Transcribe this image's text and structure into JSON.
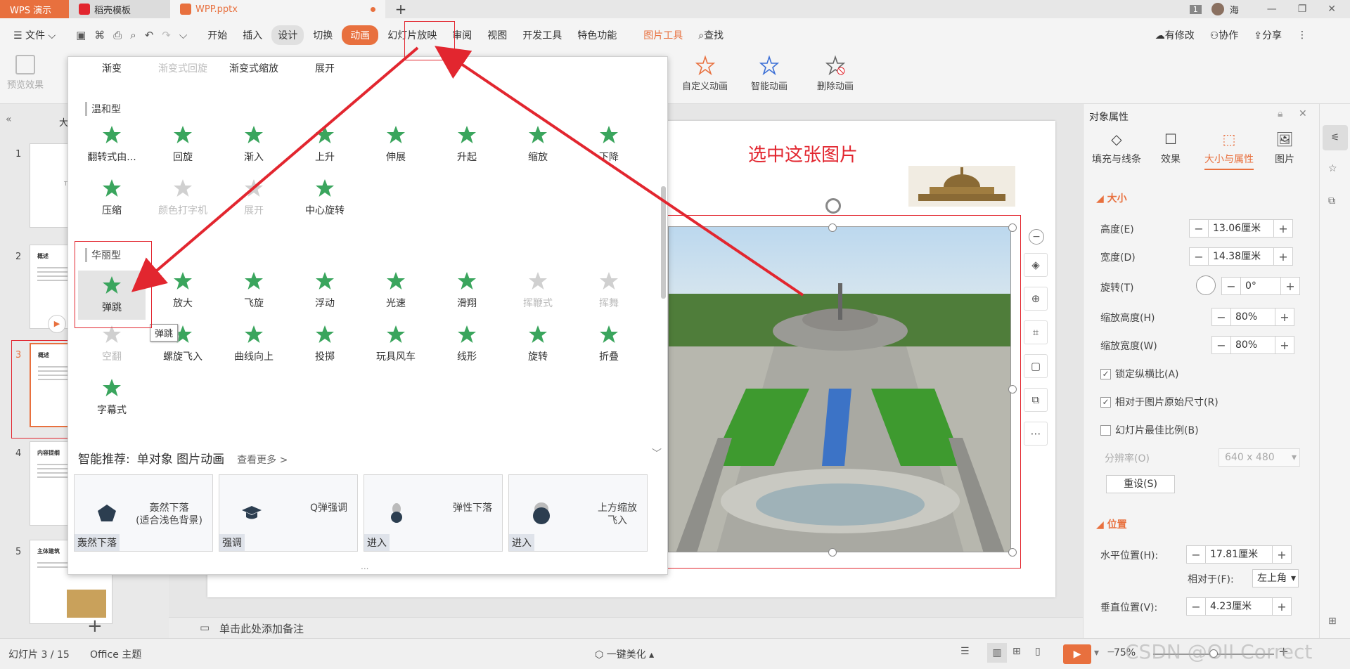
{
  "titlebar": {
    "app_tab": "WPS 演示",
    "template_tab": "稻壳模板",
    "doc_tab": "WPP.pptx",
    "user_name": "海",
    "badge": "1"
  },
  "menubar": {
    "file": "文件",
    "items": [
      "开始",
      "插入",
      "设计",
      "切换",
      "动画",
      "幻灯片放映",
      "审阅",
      "视图",
      "开发工具",
      "特色功能"
    ],
    "picture_tools": "图片工具",
    "search": "查找",
    "right": {
      "modified": "有修改",
      "collab": "协作",
      "share": "分享"
    }
  },
  "ribbon": {
    "preview": "预览效果",
    "custom_anim": "自定义动画",
    "smart_anim": "智能动画",
    "delete_anim": "删除动画"
  },
  "left": {
    "collapse_label": "大",
    "slides": [
      {
        "num": "1",
        "title": "",
        "preview": "T"
      },
      {
        "num": "2",
        "title": "概述"
      },
      {
        "num": "3",
        "title": "概述"
      },
      {
        "num": "4",
        "title": "内容提纲"
      },
      {
        "num": "5",
        "title": "主体建筑"
      }
    ]
  },
  "slide": {
    "title": "选中这张图片"
  },
  "dropdown": {
    "top_row": [
      {
        "label": "渐变",
        "disabled": false
      },
      {
        "label": "渐变式回旋",
        "disabled": true
      },
      {
        "label": "渐变式缩放",
        "disabled": false
      },
      {
        "label": "展开",
        "disabled": false
      }
    ],
    "section_mild": "温和型",
    "mild": [
      {
        "label": "翻转式由...",
        "disabled": false
      },
      {
        "label": "回旋",
        "disabled": false
      },
      {
        "label": "渐入",
        "disabled": false
      },
      {
        "label": "上升",
        "disabled": false
      },
      {
        "label": "伸展",
        "disabled": false
      },
      {
        "label": "升起",
        "disabled": false
      },
      {
        "label": "缩放",
        "disabled": false
      },
      {
        "label": "下降",
        "disabled": false
      },
      {
        "label": "压缩",
        "disabled": false
      },
      {
        "label": "颜色打字机",
        "disabled": true
      },
      {
        "label": "展开",
        "disabled": true
      },
      {
        "label": "中心旋转",
        "disabled": false
      }
    ],
    "section_fancy": "华丽型",
    "fancy": [
      {
        "label": "弹跳",
        "disabled": false
      },
      {
        "label": "放大",
        "disabled": false
      },
      {
        "label": "飞旋",
        "disabled": false
      },
      {
        "label": "浮动",
        "disabled": false
      },
      {
        "label": "光速",
        "disabled": false
      },
      {
        "label": "滑翔",
        "disabled": false
      },
      {
        "label": "挥鞭式",
        "disabled": true
      },
      {
        "label": "挥舞",
        "disabled": true
      },
      {
        "label": "空翻",
        "disabled": true
      },
      {
        "label": "螺旋飞入",
        "disabled": false
      },
      {
        "label": "曲线向上",
        "disabled": false
      },
      {
        "label": "投掷",
        "disabled": false
      },
      {
        "label": "玩具风车",
        "disabled": false
      },
      {
        "label": "线形",
        "disabled": false
      },
      {
        "label": "旋转",
        "disabled": false
      },
      {
        "label": "折叠",
        "disabled": false
      },
      {
        "label": "字幕式",
        "disabled": false
      }
    ],
    "tooltip": "弹跳",
    "smart_title": "智能推荐:",
    "smart_sub": "单对象 图片动画",
    "see_more": "查看更多 >",
    "recs": [
      {
        "name": "轰然下落\n(适合浅色背景)",
        "tag": "轰然下落"
      },
      {
        "name": "Q弹强调",
        "tag": "强调"
      },
      {
        "name": "弹性下落",
        "tag": "进入"
      },
      {
        "name": "上方缩放\n飞入",
        "tag": "进入"
      }
    ],
    "more_dots": "..."
  },
  "rightpanel": {
    "header": "对象属性",
    "tabs": [
      "填充与线条",
      "效果",
      "大小与属性",
      "图片"
    ],
    "size_section": "大小",
    "height_label": "高度(E)",
    "height": "13.06厘米",
    "width_label": "宽度(D)",
    "width": "14.38厘米",
    "rotate_label": "旋转(T)",
    "rotate": "0°",
    "scale_h_label": "缩放高度(H)",
    "scale_h": "80%",
    "scale_w_label": "缩放宽度(W)",
    "scale_w": "80%",
    "lock_ratio": "锁定纵横比(A)",
    "relative_orig": "相对于图片原始尺寸(R)",
    "best_scale": "幻灯片最佳比例(B)",
    "resolution_label": "分辨率(O)",
    "resolution": "640 x 480",
    "reset": "重设(S)",
    "pos_section": "位置",
    "hpos_label": "水平位置(H):",
    "hpos": "17.81厘米",
    "rel_label": "相对于(F):",
    "rel": "左上角",
    "vpos_label": "垂直位置(V):",
    "vpos": "4.23厘米"
  },
  "notes": {
    "placeholder": "单击此处添加备注"
  },
  "status": {
    "slide": "幻灯片 3 / 15",
    "theme": "Office 主题",
    "beautify": "一键美化",
    "zoom": "75%",
    "watermark": "CSDN @OII Correct"
  },
  "colors": {
    "accent": "#e8703e",
    "annotation": "#e2262f",
    "star": "#3aa55d"
  }
}
